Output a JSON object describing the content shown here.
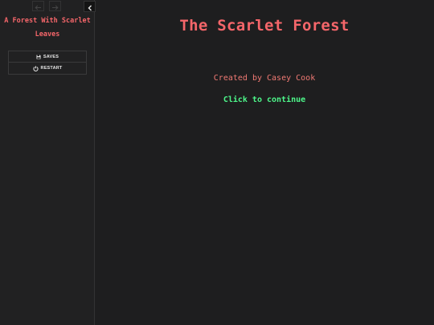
{
  "sidebar": {
    "story_title": "A Forest With Scarlet Leaves",
    "nav": {
      "back_icon": "arrow-left-icon",
      "forward_icon": "arrow-right-icon",
      "collapse_icon": "chevron-left-icon"
    },
    "menu": [
      {
        "label": "SAVES",
        "icon": "floppy-disk-icon"
      },
      {
        "label": "RESTART",
        "icon": "power-icon"
      }
    ]
  },
  "passage": {
    "title": "The Scarlet Forest",
    "byline": "Created by Casey Cook",
    "continue_link": "Click to continue"
  },
  "colors": {
    "background": "#1e1e1f",
    "sidebar": "#212122",
    "title_red": "#f5666a",
    "byline_red": "#f17a74",
    "link_green": "#4df78a",
    "menu_text": "#e6e6e6"
  }
}
